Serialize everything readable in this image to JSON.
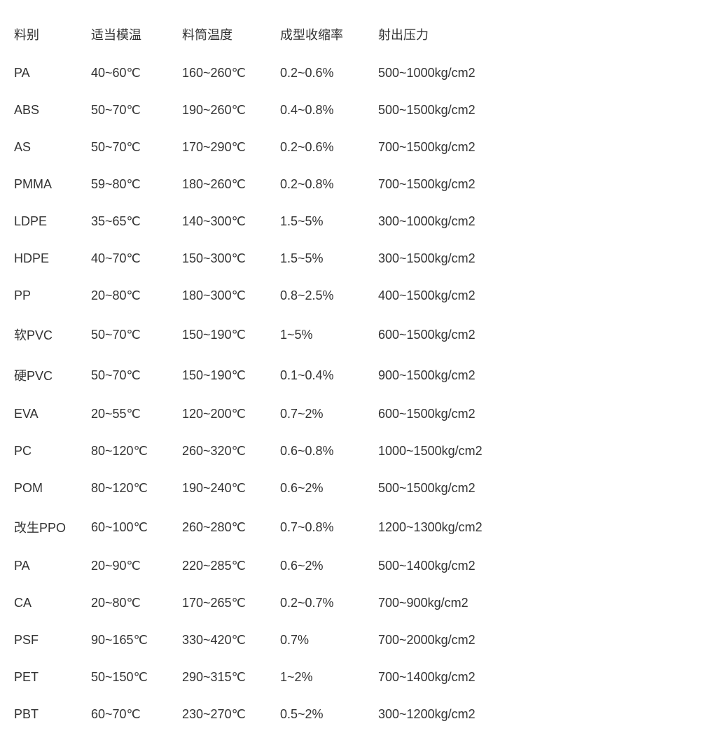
{
  "table": {
    "headers": [
      "料别",
      "适当模温",
      "料筒温度",
      "成型收缩率",
      "射出压力"
    ],
    "rows": [
      [
        "PA",
        "40~60℃",
        "160~260℃",
        "0.2~0.6%",
        "500~1000kg/cm2"
      ],
      [
        "ABS",
        "50~70℃",
        "190~260℃",
        "0.4~0.8%",
        "500~1500kg/cm2"
      ],
      [
        "AS",
        "50~70℃",
        "170~290℃",
        "0.2~0.6%",
        "700~1500kg/cm2"
      ],
      [
        "PMMA",
        "59~80℃",
        "180~260℃",
        "0.2~0.8%",
        "700~1500kg/cm2"
      ],
      [
        "LDPE",
        "35~65℃",
        "140~300℃",
        "1.5~5%",
        "300~1000kg/cm2"
      ],
      [
        "HDPE",
        "40~70℃",
        "150~300℃",
        "1.5~5%",
        "300~1500kg/cm2"
      ],
      [
        "PP",
        "20~80℃",
        "180~300℃",
        "0.8~2.5%",
        "400~1500kg/cm2"
      ],
      [
        "软PVC",
        "50~70℃",
        "150~190℃",
        "1~5%",
        "600~1500kg/cm2"
      ],
      [
        "硬PVC",
        "50~70℃",
        "150~190℃",
        "0.1~0.4%",
        "900~1500kg/cm2"
      ],
      [
        "EVA",
        "20~55℃",
        "120~200℃",
        "0.7~2%",
        "600~1500kg/cm2"
      ],
      [
        "PC",
        "80~120℃",
        "260~320℃",
        "0.6~0.8%",
        "1000~1500kg/cm2"
      ],
      [
        "POM",
        "80~120℃",
        "190~240℃",
        "0.6~2%",
        "500~1500kg/cm2"
      ],
      [
        "改生PPO",
        "60~100℃",
        "260~280℃",
        "0.7~0.8%",
        "1200~1300kg/cm2"
      ],
      [
        "PA",
        "20~90℃",
        "220~285℃",
        "0.6~2%",
        "500~1400kg/cm2"
      ],
      [
        "CA",
        "20~80℃",
        "170~265℃",
        "0.2~0.7%",
        "700~900kg/cm2"
      ],
      [
        "PSF",
        "90~165℃",
        "330~420℃",
        "0.7%",
        "700~2000kg/cm2"
      ],
      [
        "PET",
        "50~150℃",
        "290~315℃",
        "1~2%",
        "700~1400kg/cm2"
      ],
      [
        "PBT",
        "60~70℃",
        "230~270℃",
        "0.5~2%",
        "300~1200kg/cm2"
      ]
    ]
  }
}
